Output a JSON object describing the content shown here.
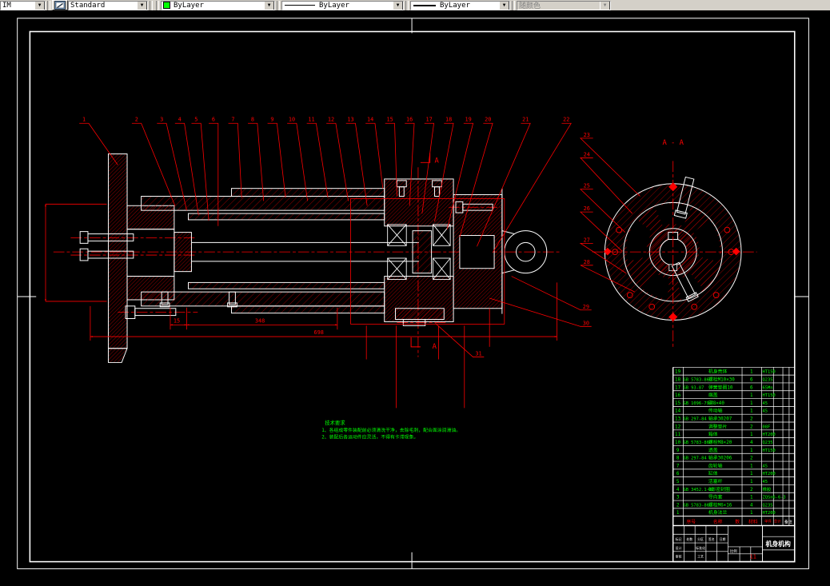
{
  "toolbar": {
    "dim_style_value": "IM",
    "text_style_value": "Standard",
    "color_value": "ByLayer",
    "color_swatch": "#00ff00",
    "linetype_value": "ByLayer",
    "lineweight_value": "ByLayer",
    "plot_style_value": "随颜色"
  },
  "drawing": {
    "colors": {
      "geometry": "#ff0000",
      "outline": "#ffffff",
      "annotation": "#00ff00"
    },
    "section_view_title": "A - A",
    "section_mark": "A",
    "dimensions": {
      "d15": "15",
      "d348": "348",
      "d698": "698"
    },
    "callouts_top": [
      "1",
      "2",
      "3",
      "4",
      "5",
      "6",
      "7",
      "8",
      "9",
      "10",
      "11",
      "12",
      "13",
      "14",
      "15",
      "16",
      "17",
      "18",
      "19",
      "20",
      "21",
      "22"
    ],
    "callouts_right": [
      "23",
      "24",
      "25",
      "26",
      "27",
      "28"
    ],
    "callouts_lower": [
      "29",
      "30",
      "31"
    ],
    "notes": {
      "title": "技术要求",
      "lines": [
        "1、各组成零件装配前必须清洗干净，去除毛刺，配合面涂润滑油。",
        "2、装配后各运动件应灵活，不得有卡滞现象。"
      ]
    },
    "bom": {
      "headers": {
        "seq": "序号",
        "name": "名称",
        "qty": "数",
        "material": "材料",
        "unit": "单件",
        "total": "总计",
        "note": "备注"
      },
      "rows": [
        {
          "seq": "19",
          "code": "",
          "name": "机身壳体",
          "qty": "1",
          "material": "HT150"
        },
        {
          "seq": "18",
          "code": "GB 5783-86",
          "name": "螺栓M10×30",
          "qty": "6",
          "material": "Q235"
        },
        {
          "seq": "17",
          "code": "GB 93-87",
          "name": "弹簧垫圈10",
          "qty": "6",
          "material": "65Mn"
        },
        {
          "seq": "16",
          "code": "",
          "name": "端盖",
          "qty": "1",
          "material": "HT150"
        },
        {
          "seq": "15",
          "code": "GB 1096-79",
          "name": "键8×40",
          "qty": "1",
          "material": "45"
        },
        {
          "seq": "14",
          "code": "",
          "name": "传动轴",
          "qty": "1",
          "material": "45"
        },
        {
          "seq": "13",
          "code": "GB 297-84",
          "name": "轴承30207",
          "qty": "2",
          "material": ""
        },
        {
          "seq": "12",
          "code": "",
          "name": "调整垫片",
          "qty": "2",
          "material": "08F"
        },
        {
          "seq": "11",
          "code": "",
          "name": "箱体",
          "qty": "1",
          "material": "HT200"
        },
        {
          "seq": "10",
          "code": "GB 5783-86",
          "name": "螺栓M8×20",
          "qty": "4",
          "material": "Q235"
        },
        {
          "seq": "9",
          "code": "",
          "name": "透盖",
          "qty": "1",
          "material": "HT150"
        },
        {
          "seq": "8",
          "code": "GB 297-84",
          "name": "轴承30206",
          "qty": "2",
          "material": ""
        },
        {
          "seq": "7",
          "code": "",
          "name": "齿轮轴",
          "qty": "1",
          "material": "45"
        },
        {
          "seq": "6",
          "code": "",
          "name": "缸体",
          "qty": "1",
          "material": "HT200"
        },
        {
          "seq": "5",
          "code": "",
          "name": "活塞杆",
          "qty": "1",
          "material": "45"
        },
        {
          "seq": "4",
          "code": "GB 3452.1-82",
          "name": "O形密封圈",
          "qty": "2",
          "material": "橡胶"
        },
        {
          "seq": "3",
          "code": "",
          "name": "导向套",
          "qty": "1",
          "material": "ZQSn6-6-3"
        },
        {
          "seq": "2",
          "code": "GB 5783-86",
          "name": "螺栓M6×16",
          "qty": "4",
          "material": "Q235"
        },
        {
          "seq": "1",
          "code": "",
          "name": "机身法兰",
          "qty": "1",
          "material": "HT200"
        }
      ]
    },
    "title_block": {
      "title": "机身机构",
      "sheet_no": "11",
      "labels": [
        "标记",
        "处数",
        "分区",
        "签名",
        "日期",
        "设计",
        "标准化",
        "审核",
        "工艺",
        "比例"
      ]
    }
  }
}
